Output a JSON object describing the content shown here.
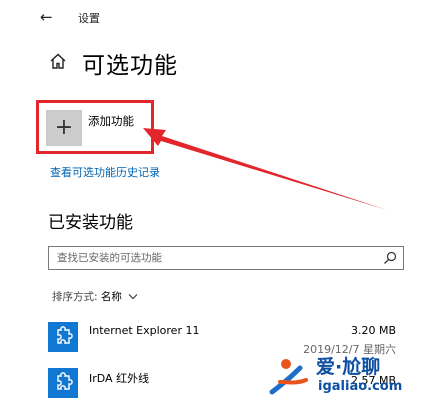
{
  "window": {
    "title": "设置"
  },
  "page": {
    "title": "可选功能"
  },
  "add_feature": {
    "label": "添加功能"
  },
  "history_link": "查看可选功能历史记录",
  "installed": {
    "section_title": "已安装功能",
    "search_placeholder": "查找已安装的可选功能",
    "sort_label": "排序方式:",
    "sort_value": "名称",
    "features": [
      {
        "name": "Internet Explorer 11",
        "size": "3.20 MB",
        "date": "2019/12/7 星期六"
      },
      {
        "name": "IrDA 红外线",
        "size": "2.57 MB",
        "date": ""
      }
    ]
  },
  "watermark": {
    "brand": "爱·尬聊",
    "url": "igaliao.com"
  },
  "colors": {
    "accent": "#0063b1",
    "tile_blue": "#1077d2",
    "highlight": "#e3262b"
  }
}
